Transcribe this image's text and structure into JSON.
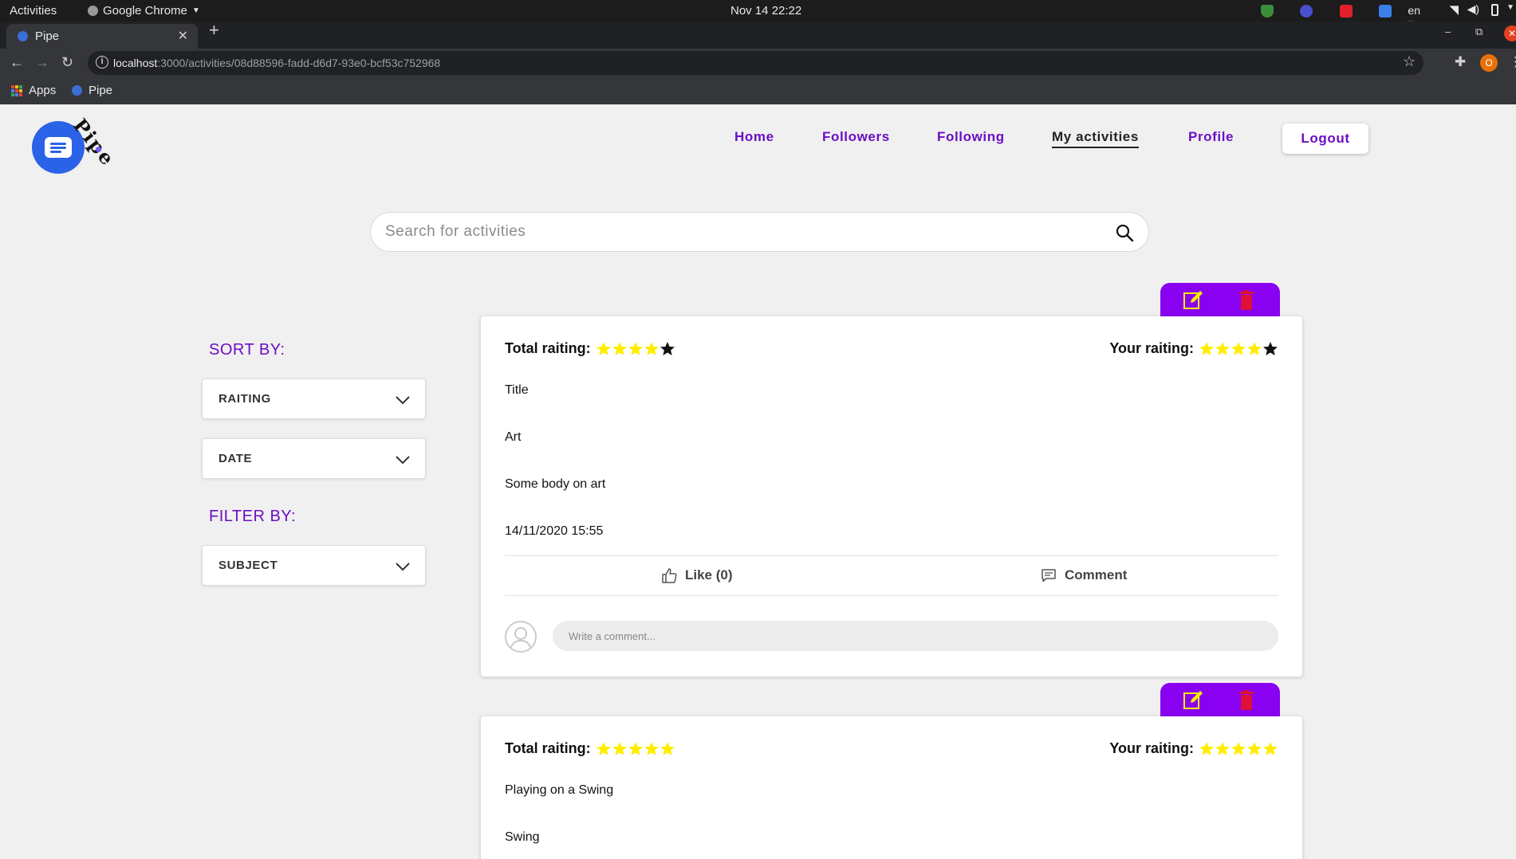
{
  "os": {
    "activities": "Activities",
    "app_name": "Google Chrome",
    "clock": "Nov 14  22:22",
    "lang": "en"
  },
  "browser": {
    "tab_title": "Pipe",
    "url_host": "localhost",
    "url_path": ":3000/activities/08d88596-fadd-d6d7-93e0-bcf53c752968",
    "profile_initial": "O",
    "bookmarks": [
      {
        "label": "Apps"
      },
      {
        "label": "Pipe"
      }
    ]
  },
  "app": {
    "logo_text": "Pipe",
    "nav": [
      {
        "label": "Home"
      },
      {
        "label": "Followers"
      },
      {
        "label": "Following"
      },
      {
        "label": "My activities"
      },
      {
        "label": "Profile"
      }
    ],
    "logout_label": "Logout",
    "accent_color": "#8a00f0",
    "link_color": "#6b0fc4",
    "star_color": "#ffee00"
  },
  "search": {
    "placeholder": "Search for activities",
    "value": ""
  },
  "sidebar": {
    "sort_title": "SORT BY:",
    "sort_options": [
      {
        "label": "RAITING"
      },
      {
        "label": "DATE"
      }
    ],
    "filter_title": "FILTER BY:",
    "filter_options": [
      {
        "label": "SUBJECT"
      }
    ]
  },
  "activities": [
    {
      "total_label": "Total raiting:",
      "total_rating": 4,
      "your_label": "Your raiting:",
      "your_rating": 4,
      "title": "Title",
      "subject": "Art",
      "body": "Some body on art",
      "date": "14/11/2020 15:55",
      "like_label": "Like (0)",
      "comment_label": "Comment",
      "comment_placeholder": "Write a comment..."
    },
    {
      "total_label": "Total raiting:",
      "total_rating": 5,
      "your_label": "Your raiting:",
      "your_rating": 5,
      "title": "Playing on a Swing",
      "subject": "Swing"
    }
  ]
}
